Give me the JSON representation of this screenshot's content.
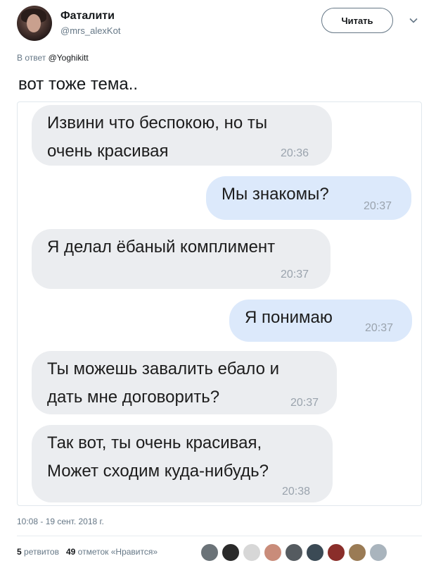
{
  "author": {
    "name": "Фаталити",
    "handle": "@mrs_alexKot"
  },
  "follow_button": {
    "label": "Читать"
  },
  "reply": {
    "prefix": "В ответ ",
    "mention": "@Yoghikitt"
  },
  "tweet_text": "вот тоже тема..",
  "messages": [
    {
      "side": "in",
      "text": "Извини что беспокою, но ты\nочень красивая",
      "time": "20:36"
    },
    {
      "side": "out",
      "text": "Мы знакомы?",
      "time": "20:37"
    },
    {
      "side": "in",
      "text": "Я делал ёбаный комплимент",
      "time": "20:37"
    },
    {
      "side": "out",
      "text": "Я понимаю",
      "time": "20:37"
    },
    {
      "side": "in",
      "text": "Ты можешь завалить ебало и\nдать мне договорить?",
      "time": "20:37"
    },
    {
      "side": "in",
      "text": "Так вот, ты очень красивая,\nМожет сходим куда-нибудь?",
      "time": "20:38"
    }
  ],
  "timestamp": "10:08 - 19 сент. 2018 г.",
  "stats": {
    "retweets_count": "5",
    "retweets_label": "ретвитов",
    "likes_count": "49",
    "likes_label": "отметок «Нравится»"
  },
  "likers": [
    "#6b7378",
    "#2a2a2a",
    "#d7d7d7",
    "#c98c7a",
    "#555b60",
    "#3b4a55",
    "#8a2e2a",
    "#9a7b55",
    "#a9b4bd"
  ]
}
